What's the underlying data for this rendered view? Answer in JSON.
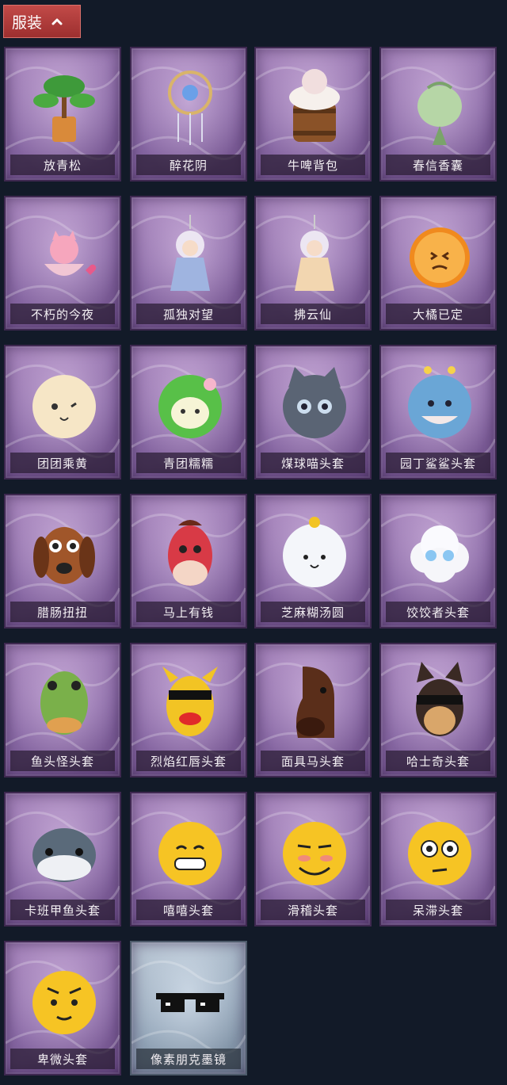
{
  "header": {
    "title": "服装",
    "chevron_icon": "chevron-up-icon"
  },
  "items": [
    {
      "label": "放青松",
      "icon": "bonsai-pine-icon"
    },
    {
      "label": "醉花阴",
      "icon": "dreamcatcher-icon"
    },
    {
      "label": "牛啤背包",
      "icon": "cow-beer-barrel-backpack-icon"
    },
    {
      "label": "春信香囊",
      "icon": "green-sachet-icon"
    },
    {
      "label": "不朽的今夜",
      "icon": "pink-cat-bowl-charm-icon"
    },
    {
      "label": "孤独对望",
      "icon": "white-haired-doll-charm-icon"
    },
    {
      "label": "拂云仙",
      "icon": "fairy-doll-charm-icon"
    },
    {
      "label": "大橘已定",
      "icon": "orange-slice-icon"
    },
    {
      "label": "团团乘黄",
      "icon": "cream-bun-mask-icon"
    },
    {
      "label": "青团糯糯",
      "icon": "green-rice-ball-mask-icon"
    },
    {
      "label": "煤球喵头套",
      "icon": "gray-cat-mask-icon"
    },
    {
      "label": "园丁鲨鲨头套",
      "icon": "shark-bee-mask-icon"
    },
    {
      "label": "腊肠扭扭",
      "icon": "dachshund-mask-icon"
    },
    {
      "label": "马上有钱",
      "icon": "red-horse-mask-icon"
    },
    {
      "label": "芝麻糊汤圆",
      "icon": "dumpling-flower-mask-icon"
    },
    {
      "label": "饺饺者头套",
      "icon": "cloud-dumpling-mask-icon"
    },
    {
      "label": "鱼头怪头套",
      "icon": "fish-head-mask-icon"
    },
    {
      "label": "烈焰红唇头套",
      "icon": "yellow-red-lips-mask-icon"
    },
    {
      "label": "面具马头套",
      "icon": "horse-head-mask-icon"
    },
    {
      "label": "哈士奇头套",
      "icon": "husky-sunglasses-mask-icon"
    },
    {
      "label": "卡班甲鱼头套",
      "icon": "fish-blob-mask-icon"
    },
    {
      "label": "嘻嘻头套",
      "icon": "grinning-emoji-mask-icon"
    },
    {
      "label": "滑稽头套",
      "icon": "smirk-emoji-mask-icon"
    },
    {
      "label": "呆滞头套",
      "icon": "dazed-emoji-mask-icon"
    },
    {
      "label": "卑微头套",
      "icon": "pleading-emoji-mask-icon"
    },
    {
      "label": "像素朋克墨镜",
      "icon": "pixel-sunglasses-icon"
    }
  ],
  "colors": {
    "background": "#121a28",
    "header": "#b23c3c",
    "card_purple": "#8a6aa6",
    "card_silver": "#94a6b9"
  }
}
